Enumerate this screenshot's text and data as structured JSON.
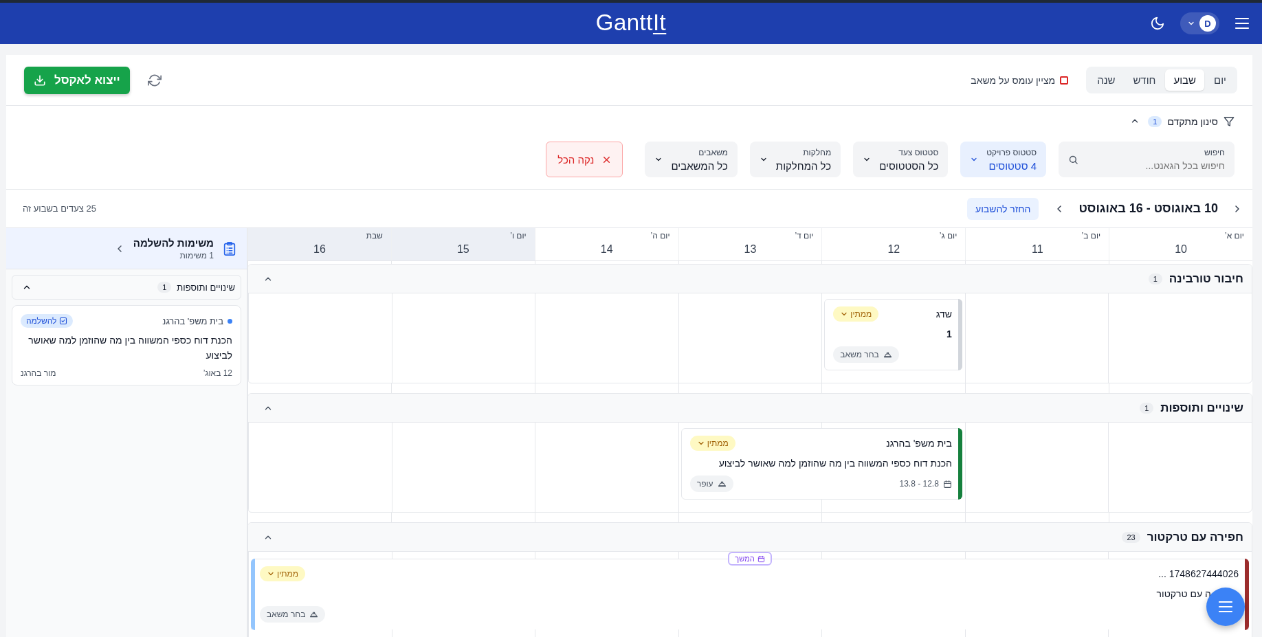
{
  "header": {
    "logo": "Gantt",
    "logo_suffix": "It",
    "avatar": "D"
  },
  "toolbar": {
    "export_button": "ייצוא לאקסל",
    "view_tabs": [
      {
        "label": "יום",
        "selected": false
      },
      {
        "label": "שבוע",
        "selected": true
      },
      {
        "label": "חודש",
        "selected": false
      },
      {
        "label": "שנה",
        "selected": false
      }
    ],
    "load_indicator": {
      "label": "מציין עומס על משאב",
      "checked": false
    }
  },
  "filters": {
    "title": "סינון מתקדם",
    "count": "1",
    "expanded": true,
    "fields": [
      {
        "kind": "search",
        "label": "חיפוש",
        "placeholder": "חיפוש בכל הגאנט..."
      },
      {
        "kind": "select",
        "label": "סטטוס פרויקט",
        "value": "4 סטטוסים",
        "active": true
      },
      {
        "kind": "select",
        "label": "סטטוס צעד",
        "value": "כל הסטטוסים",
        "active": false
      },
      {
        "kind": "select",
        "label": "מחלקות",
        "value": "כל המחלקות",
        "active": false
      },
      {
        "kind": "select",
        "label": "משאבים",
        "value": "כל המשאבים",
        "active": false
      }
    ],
    "clear_button": "נקה הכל"
  },
  "week": {
    "range": "10 באוגוסט - 16 באוגוסט",
    "today_button": "החזר להשבוע",
    "summary": "25 צעדים בשבוע זה"
  },
  "days": [
    {
      "name": "יום א’",
      "date": "10",
      "weekend": false
    },
    {
      "name": "יום ב’",
      "date": "11",
      "weekend": false
    },
    {
      "name": "יום ג’",
      "date": "12",
      "weekend": false
    },
    {
      "name": "יום ד’",
      "date": "13",
      "weekend": false
    },
    {
      "name": "יום ה’",
      "date": "14",
      "weekend": false
    },
    {
      "name": "יום ו’",
      "date": "15",
      "weekend": true
    },
    {
      "name": "שבת",
      "date": "16",
      "weekend": true
    }
  ],
  "groups": [
    {
      "title": "חיבור טורבינה",
      "count": "1",
      "expanded": true,
      "tasks": [
        {
          "title": "שדג",
          "status": "ממתין",
          "description": "1",
          "resource": "בחר משאב",
          "color": "#d1d5db",
          "covers": [
            false,
            false,
            true,
            false,
            false,
            false,
            false
          ],
          "continues": false
        }
      ]
    },
    {
      "title": "שינויים ותוספות",
      "count": "1",
      "expanded": true,
      "tasks": [
        {
          "title": "בית משפ' בהרגנ",
          "status": "ממתין",
          "description": "הכנת דוח כספי המשווה בין מה שהוזמן למה שאושר לביצוע",
          "dates": "13.8 - 12.8",
          "resource": "עופר",
          "color": "#15803d",
          "covers": [
            false,
            false,
            true,
            true,
            false,
            false,
            false
          ],
          "continues": false
        }
      ]
    },
    {
      "title": "חפירה עם טרקטור",
      "count": "23",
      "expanded": true,
      "tasks": [
        {
          "title": "1748627444026 ...",
          "status": "ממתין",
          "description": "ה עם טרקטור",
          "resource": "בחר משאב",
          "color": "#9b2c2c",
          "covers": [
            true,
            true,
            true,
            true,
            true,
            true,
            true
          ],
          "continues": true,
          "continue_label": "המשך"
        }
      ]
    }
  ],
  "sidebar": {
    "title": "משימות להשלמה",
    "subtitle": "1 משימות",
    "groups": [
      {
        "title": "שינויים ותוספות",
        "count": "1",
        "expanded": true,
        "tasks": [
          {
            "project": "בית משפ' בהרגנ",
            "color": "#3b82f6",
            "badge": "להשלמה",
            "description": "הכנת דוח כספי המשווה בין מה שהוזמן למה שאושר לביצוע",
            "date": "12 באוג’",
            "owner": "מור בהרגנ"
          }
        ]
      }
    ]
  }
}
